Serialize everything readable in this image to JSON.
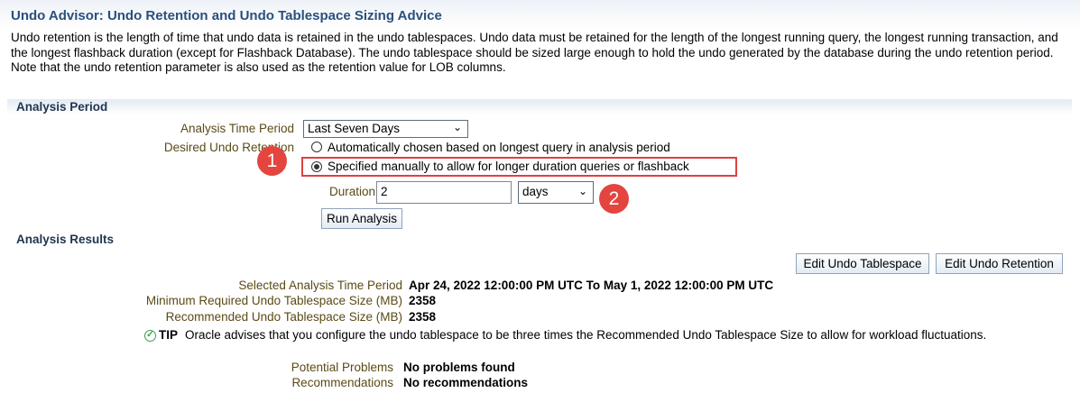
{
  "header": {
    "title": "Undo Advisor: Undo Retention and Undo Tablespace Sizing Advice",
    "description": "Undo retention is the length of time that undo data is retained in the undo tablespaces. Undo data must be retained for the length of the longest running query, the longest running transaction, and the longest flashback duration (except for Flashback Database). The undo tablespace should be sized large enough to hold the undo generated by the database during the undo retention period. Note that the undo retention parameter is also used as the retention value for LOB columns."
  },
  "analysis_period": {
    "section_title": "Analysis Period",
    "time_period_label": "Analysis Time Period",
    "time_period_value": "Last Seven Days",
    "desired_retention_label": "Desired Undo Retention",
    "radio_auto_label": "Automatically chosen based on longest query in analysis period",
    "radio_manual_label": "Specified manually to allow for longer duration queries or flashback",
    "selected_option": "manual",
    "duration_label": "Duration",
    "duration_value": "2",
    "duration_unit": "days",
    "run_button": "Run Analysis"
  },
  "markers": {
    "one": "1",
    "two": "2"
  },
  "results": {
    "section_title": "Analysis Results",
    "edit_tablespace_button": "Edit Undo Tablespace",
    "edit_retention_button": "Edit Undo Retention",
    "selected_period_label": "Selected Analysis Time Period",
    "selected_period_value": "Apr 24, 2022 12:00:00 PM UTC To May 1, 2022 12:00:00 PM UTC",
    "min_size_label": "Minimum Required Undo Tablespace Size (MB)",
    "min_size_value": "2358",
    "rec_size_label": "Recommended Undo Tablespace Size (MB)",
    "rec_size_value": "2358",
    "tip_label": "TIP",
    "tip_text": "Oracle advises that you configure the undo tablespace to be three times the Recommended Undo Tablespace Size to allow for workload fluctuations.",
    "problems_label": "Potential Problems",
    "problems_value": "No problems found",
    "recommendations_label": "Recommendations",
    "recommendations_value": "No recommendations"
  },
  "colors": {
    "title": "#2a4f7c",
    "label": "#5b4a15",
    "marker": "#e4453f",
    "tip_icon": "#3b9d4a"
  }
}
